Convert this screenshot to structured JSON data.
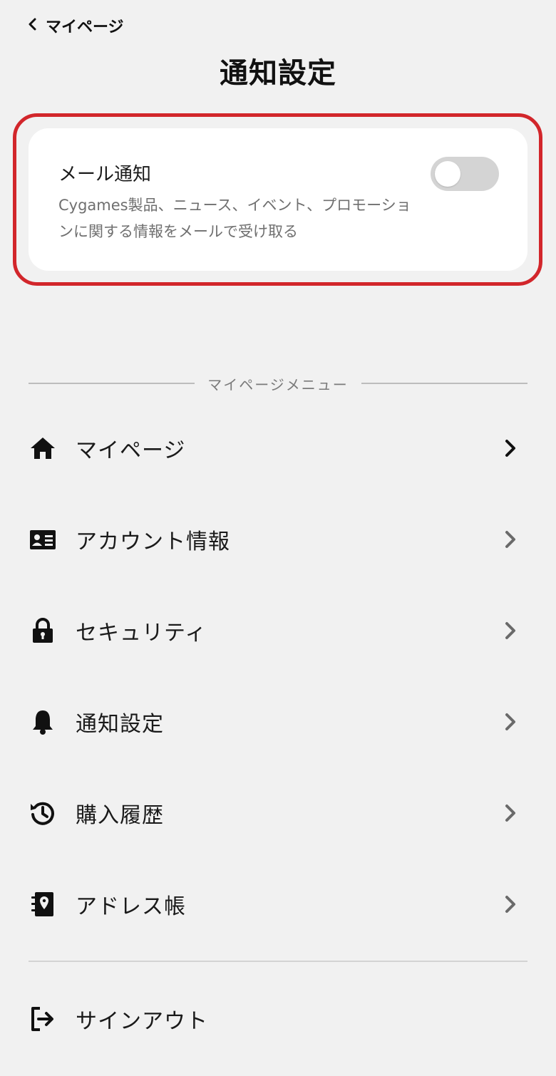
{
  "header": {
    "back_label": "マイページ",
    "title": "通知設定"
  },
  "notification_card": {
    "title": "メール通知",
    "description": "Cygames製品、ニュース、イベント、プロモーションに関する情報をメールで受け取る",
    "toggle_on": false,
    "highlight_color": "#d2262b"
  },
  "menu": {
    "section_label": "マイページメニュー",
    "items": [
      {
        "label": "マイページ",
        "icon": "home-icon",
        "chevron_color": "#111111"
      },
      {
        "label": "アカウント情報",
        "icon": "id-card-icon",
        "chevron_color": "#6a6a6a"
      },
      {
        "label": "セキュリティ",
        "icon": "lock-icon",
        "chevron_color": "#6a6a6a"
      },
      {
        "label": "通知設定",
        "icon": "bell-icon",
        "chevron_color": "#6a6a6a"
      },
      {
        "label": "購入履歴",
        "icon": "history-icon",
        "chevron_color": "#6a6a6a"
      },
      {
        "label": "アドレス帳",
        "icon": "address-book-icon",
        "chevron_color": "#6a6a6a"
      }
    ],
    "signout_label": "サインアウト",
    "signout_icon": "sign-out-icon"
  }
}
